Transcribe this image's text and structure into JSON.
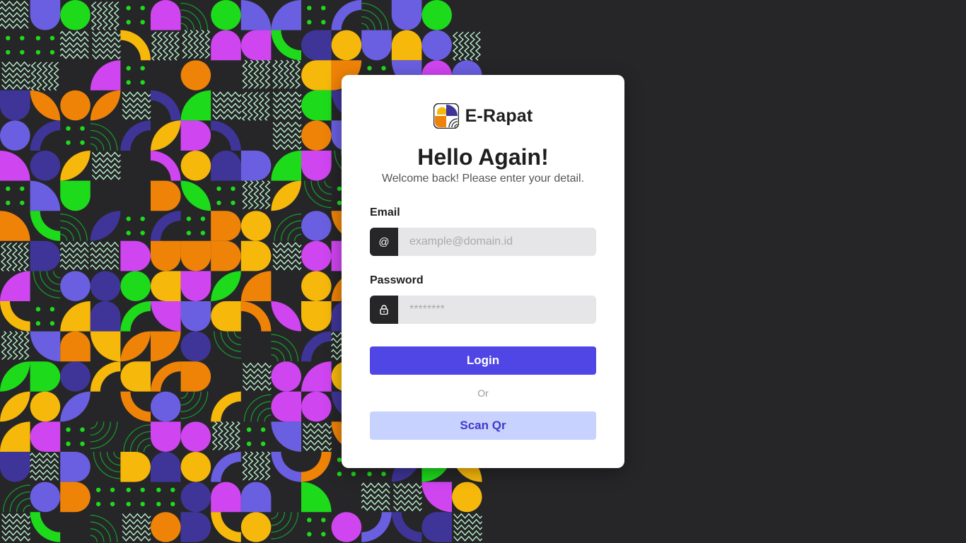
{
  "brand": {
    "name": "E-Rapat",
    "logo_icon": "e-rapat-logo-icon"
  },
  "heading": {
    "title": "Hello Again!",
    "subtitle": "Welcome back! Please enter your detail."
  },
  "form": {
    "email": {
      "label": "Email",
      "icon": "@",
      "placeholder": "example@domain.id",
      "value": ""
    },
    "password": {
      "label": "Password",
      "icon": "lock-icon",
      "placeholder": "********",
      "value": ""
    },
    "login_label": "Login",
    "or_text": "Or",
    "scan_label": "Scan Qr"
  },
  "colors": {
    "background": "#262628",
    "primary": "#4f46e5",
    "secondary_bg": "#c7d2fe",
    "secondary_text": "#4338ca",
    "pattern": [
      "#ef8307",
      "#f6b80a",
      "#6a5fe0",
      "#3f3598",
      "#cf45f0",
      "#1ddb1b",
      "#b9f2cc"
    ]
  }
}
